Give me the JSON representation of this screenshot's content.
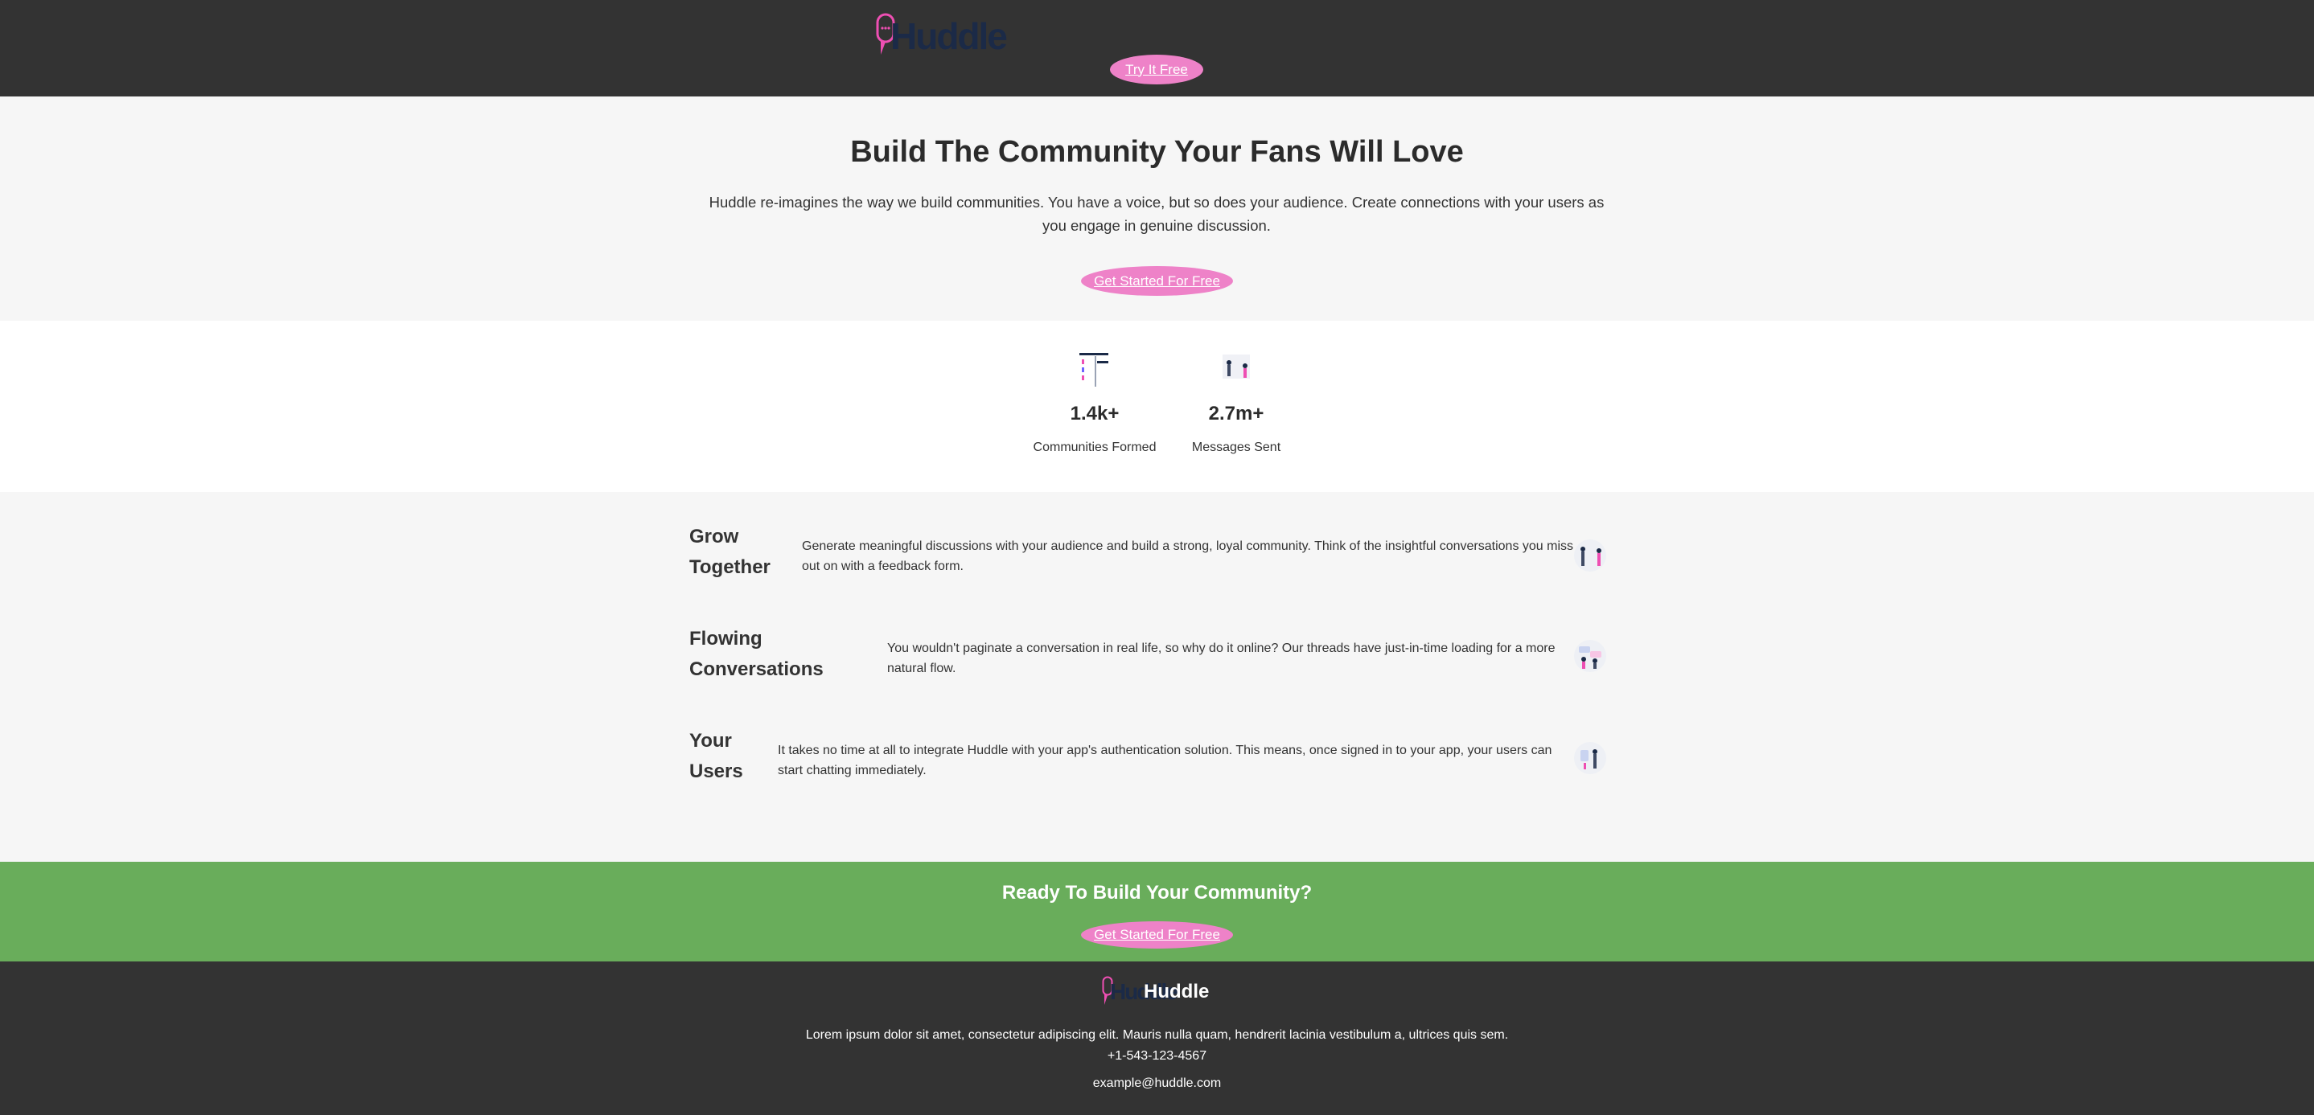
{
  "header": {
    "logo_text": "Huddle",
    "try_button": "Try It Free"
  },
  "hero": {
    "title": "Build The Community Your Fans Will Love",
    "description": "Huddle re-imagines the way we build communities. You have a voice, but so does your audience. Create connections with your users as you engage in genuine discussion.",
    "cta": "Get Started For Free"
  },
  "stats": [
    {
      "value": "1.4k+",
      "label": "Communities Formed",
      "icon": "communities-icon"
    },
    {
      "value": "2.7m+",
      "label": "Messages Sent",
      "icon": "messages-icon"
    }
  ],
  "features": [
    {
      "title": "Grow Together",
      "text": "Generate meaningful discussions with your audience and build a strong, loyal community. Think of the insightful conversations you miss out on with a feedback form.",
      "icon": "grow-together-illustration"
    },
    {
      "title": "Flowing Conversations",
      "text": "You wouldn't paginate a conversation in real life, so why do it online? Our threads have just-in-time loading for a more natural flow.",
      "icon": "flowing-conversations-illustration"
    },
    {
      "title": "Your Users",
      "text": "It takes no time at all to integrate Huddle with your app's authentication solution. This means, once signed in to your app, your users can start chatting immediately.",
      "icon": "your-users-illustration"
    }
  ],
  "cta": {
    "title": "Ready To Build Your Community?",
    "button": "Get Started For Free"
  },
  "footer": {
    "logo_text": "Huddle",
    "brand": "Huddle",
    "lorem": "Lorem ipsum dolor sit amet, consectetur adipiscing elit. Mauris nulla quam, hendrerit lacinia vestibulum a, ultrices quis sem.",
    "phone": "+1-543-123-4567",
    "email": "example@huddle.com"
  },
  "colors": {
    "header_bg": "#333333",
    "accent_pink": "#ee82c8",
    "cta_green": "#69ad5b",
    "page_bg": "#f6f6f6",
    "logo_navy": "#1b2a47"
  }
}
